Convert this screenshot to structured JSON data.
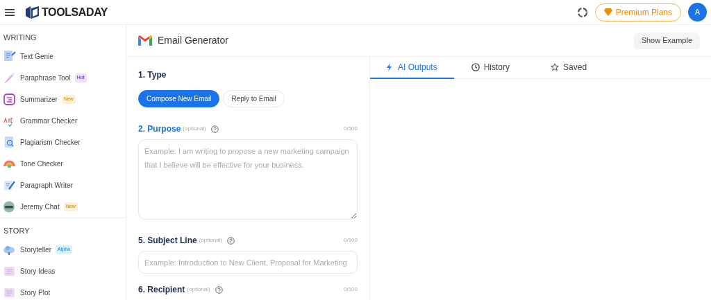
{
  "header": {
    "brand": "TOOLSADAY",
    "premium_button": "Premium Plans",
    "avatar": "A"
  },
  "sidebar": {
    "sections": [
      {
        "title": "WRITING",
        "items": [
          {
            "label": "Text Genie"
          },
          {
            "label": "Paraphrase Tool",
            "badge": {
              "label": "Hot",
              "color": "#ede4fb"
            }
          },
          {
            "label": "Summarizer",
            "badge": {
              "label": "New",
              "color": "#fdf0d9"
            }
          },
          {
            "label": "Grammar Checker"
          },
          {
            "label": "Plagiarism Checker"
          },
          {
            "label": "Tone Checker"
          },
          {
            "label": "Paragraph Writer"
          },
          {
            "label": "Jeremy Chat",
            "badge": {
              "label": "New",
              "color": "#fdf0d9"
            }
          }
        ]
      },
      {
        "title": "STORY",
        "items": [
          {
            "label": "Storyteller",
            "badge": {
              "label": "Alpha",
              "color": "#dcf1fb"
            }
          },
          {
            "label": "Story Ideas"
          },
          {
            "label": "Story Plot"
          }
        ]
      }
    ]
  },
  "tool": {
    "title": "Email Generator",
    "show_example": "Show Example",
    "type_section": {
      "label": "1. Type",
      "options": [
        {
          "label": "Compose New Email",
          "selected": true
        },
        {
          "label": "Reply to Email",
          "selected": false
        }
      ]
    },
    "fields": [
      {
        "kind": "textarea",
        "label": "2. Purpose",
        "hint": "(optional)",
        "count": "0/500",
        "placeholder": "Example: I am writing to propose a new marketing campaign that I believe will be effective for your business.",
        "active": true
      },
      {
        "kind": "input",
        "label": "5. Subject Line",
        "hint": "(optional)",
        "count": "0/100",
        "placeholder": "Example: Introduction to New Client, Proposal for Marketing",
        "active": false
      },
      {
        "kind": "label",
        "label": "6. Recipient",
        "hint": "(optional)",
        "count": "0/100",
        "active": false
      }
    ]
  },
  "output_tabs": [
    {
      "label": "AI Outputs",
      "selected": true
    },
    {
      "label": "History",
      "selected": false
    },
    {
      "label": "Saved",
      "selected": false
    }
  ]
}
